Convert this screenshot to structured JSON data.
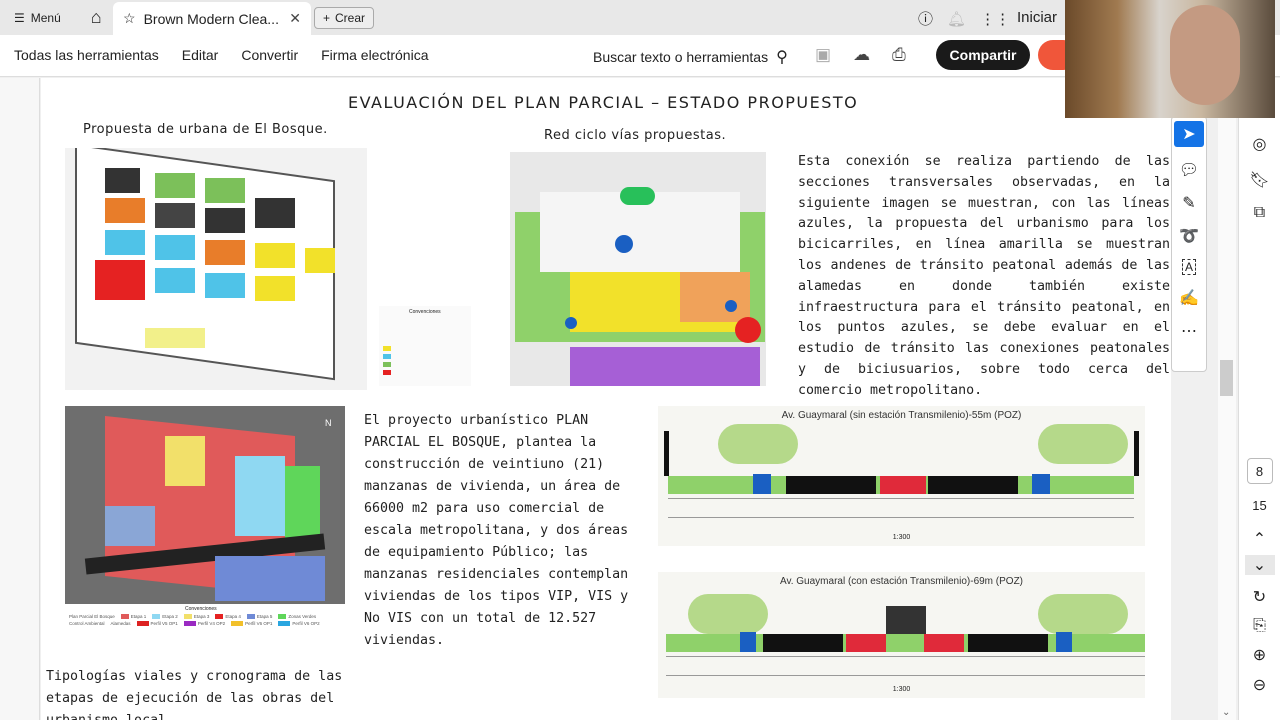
{
  "topbar": {
    "menu_label": "Menú",
    "tab_title": "Brown Modern Clea...",
    "create_label": "Crear",
    "signin_label": "Iniciar"
  },
  "toolbar": {
    "items": [
      "Todas las herramientas",
      "Editar",
      "Convertir",
      "Firma electrónica"
    ],
    "search_label": "Buscar texto o herramientas",
    "share_label": "Compartir"
  },
  "document": {
    "title": "EVALUACIÓN DEL PLAN PARCIAL – ESTADO PROPUESTO",
    "caption_urban": "Propuesta de urbana de El Bosque.",
    "caption_bike": "Red ciclo vías propuestas.",
    "paragraph_right": "Esta conexión se realiza partiendo de las secciones transversales observadas, en la siguiente imagen se muestran, con las líneas azules, la propuesta del urbanismo para los bicicarriles, en línea amarilla se muestran los andenes de tránsito peatonal además de las alamedas en donde también existe infraestructura para el tránsito peatonal, en los puntos azules, se debe evaluar en el estudio de tránsito las conexiones peatonales y de biciusuarios, sobre todo cerca del comercio metropolitano.",
    "paragraph_middle": "El proyecto urbanístico PLAN PARCIAL EL BOSQUE, plantea la construcción de veintiuno (21) manzanas de vivienda, un área de 66000 m2 para uso comercial de escala metropolitana, y dos áreas de equipamiento Público; las manzanas residenciales contemplan viviendas de los tipos VIP, VIS y No VIS con un total de 12.527 viviendas.",
    "caption_bottom": "Tipologías viales y cronograma de las etapas de ejecución de las obras del urbanismo local",
    "section1_title": "Av. Guaymaral (sin estación Transmilenio)-55m (POZ)",
    "section1_scale": "1:300",
    "section2_title": "Av. Guaymaral (con estación Transmilenio)-69m (POZ)",
    "section2_scale": "1:300",
    "map_legend_title": "Convenciones",
    "map_legend": [
      "Plan Parcial El Bosque",
      "Etapa 1",
      "Etapa 2",
      "Etapa 3",
      "Etapa 4",
      "Etapa 5",
      "Zonas Verdes",
      "Control Ambiental",
      "Alamedas",
      "Perfil V5 OP1",
      "Perfil V4 OP2",
      "Perfil V6 OP1",
      "Perfil V6 OP2"
    ]
  },
  "navigation": {
    "current_page": "8",
    "total_pages": "15"
  },
  "colors": {
    "accent": "#1473e6",
    "share_bg": "#1a1a1a",
    "red_button": "#f0563a"
  }
}
